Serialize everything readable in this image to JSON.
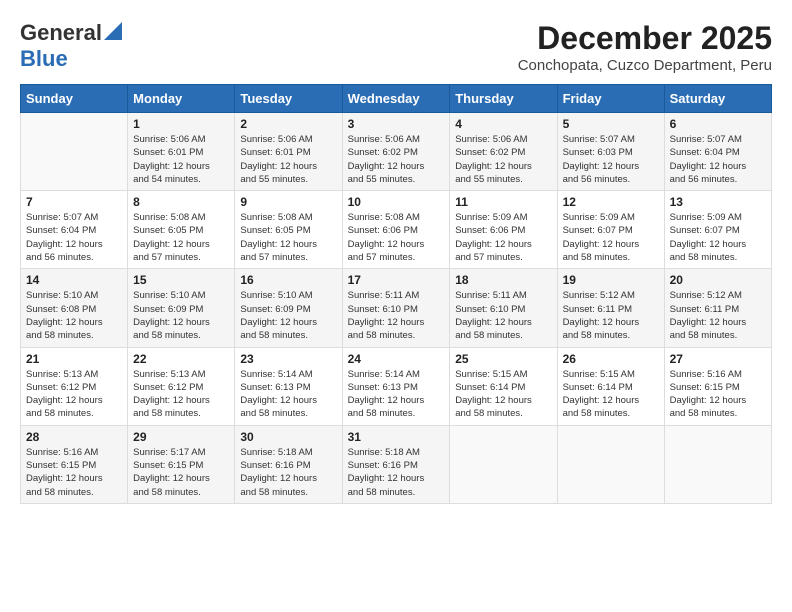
{
  "logo": {
    "general": "General",
    "blue": "Blue"
  },
  "title": "December 2025",
  "subtitle": "Conchopata, Cuzco Department, Peru",
  "header_days": [
    "Sunday",
    "Monday",
    "Tuesday",
    "Wednesday",
    "Thursday",
    "Friday",
    "Saturday"
  ],
  "weeks": [
    [
      {
        "day": "",
        "info": ""
      },
      {
        "day": "1",
        "info": "Sunrise: 5:06 AM\nSunset: 6:01 PM\nDaylight: 12 hours\nand 54 minutes."
      },
      {
        "day": "2",
        "info": "Sunrise: 5:06 AM\nSunset: 6:01 PM\nDaylight: 12 hours\nand 55 minutes."
      },
      {
        "day": "3",
        "info": "Sunrise: 5:06 AM\nSunset: 6:02 PM\nDaylight: 12 hours\nand 55 minutes."
      },
      {
        "day": "4",
        "info": "Sunrise: 5:06 AM\nSunset: 6:02 PM\nDaylight: 12 hours\nand 55 minutes."
      },
      {
        "day": "5",
        "info": "Sunrise: 5:07 AM\nSunset: 6:03 PM\nDaylight: 12 hours\nand 56 minutes."
      },
      {
        "day": "6",
        "info": "Sunrise: 5:07 AM\nSunset: 6:04 PM\nDaylight: 12 hours\nand 56 minutes."
      }
    ],
    [
      {
        "day": "7",
        "info": "Sunrise: 5:07 AM\nSunset: 6:04 PM\nDaylight: 12 hours\nand 56 minutes."
      },
      {
        "day": "8",
        "info": "Sunrise: 5:08 AM\nSunset: 6:05 PM\nDaylight: 12 hours\nand 57 minutes."
      },
      {
        "day": "9",
        "info": "Sunrise: 5:08 AM\nSunset: 6:05 PM\nDaylight: 12 hours\nand 57 minutes."
      },
      {
        "day": "10",
        "info": "Sunrise: 5:08 AM\nSunset: 6:06 PM\nDaylight: 12 hours\nand 57 minutes."
      },
      {
        "day": "11",
        "info": "Sunrise: 5:09 AM\nSunset: 6:06 PM\nDaylight: 12 hours\nand 57 minutes."
      },
      {
        "day": "12",
        "info": "Sunrise: 5:09 AM\nSunset: 6:07 PM\nDaylight: 12 hours\nand 58 minutes."
      },
      {
        "day": "13",
        "info": "Sunrise: 5:09 AM\nSunset: 6:07 PM\nDaylight: 12 hours\nand 58 minutes."
      }
    ],
    [
      {
        "day": "14",
        "info": "Sunrise: 5:10 AM\nSunset: 6:08 PM\nDaylight: 12 hours\nand 58 minutes."
      },
      {
        "day": "15",
        "info": "Sunrise: 5:10 AM\nSunset: 6:09 PM\nDaylight: 12 hours\nand 58 minutes."
      },
      {
        "day": "16",
        "info": "Sunrise: 5:10 AM\nSunset: 6:09 PM\nDaylight: 12 hours\nand 58 minutes."
      },
      {
        "day": "17",
        "info": "Sunrise: 5:11 AM\nSunset: 6:10 PM\nDaylight: 12 hours\nand 58 minutes."
      },
      {
        "day": "18",
        "info": "Sunrise: 5:11 AM\nSunset: 6:10 PM\nDaylight: 12 hours\nand 58 minutes."
      },
      {
        "day": "19",
        "info": "Sunrise: 5:12 AM\nSunset: 6:11 PM\nDaylight: 12 hours\nand 58 minutes."
      },
      {
        "day": "20",
        "info": "Sunrise: 5:12 AM\nSunset: 6:11 PM\nDaylight: 12 hours\nand 58 minutes."
      }
    ],
    [
      {
        "day": "21",
        "info": "Sunrise: 5:13 AM\nSunset: 6:12 PM\nDaylight: 12 hours\nand 58 minutes."
      },
      {
        "day": "22",
        "info": "Sunrise: 5:13 AM\nSunset: 6:12 PM\nDaylight: 12 hours\nand 58 minutes."
      },
      {
        "day": "23",
        "info": "Sunrise: 5:14 AM\nSunset: 6:13 PM\nDaylight: 12 hours\nand 58 minutes."
      },
      {
        "day": "24",
        "info": "Sunrise: 5:14 AM\nSunset: 6:13 PM\nDaylight: 12 hours\nand 58 minutes."
      },
      {
        "day": "25",
        "info": "Sunrise: 5:15 AM\nSunset: 6:14 PM\nDaylight: 12 hours\nand 58 minutes."
      },
      {
        "day": "26",
        "info": "Sunrise: 5:15 AM\nSunset: 6:14 PM\nDaylight: 12 hours\nand 58 minutes."
      },
      {
        "day": "27",
        "info": "Sunrise: 5:16 AM\nSunset: 6:15 PM\nDaylight: 12 hours\nand 58 minutes."
      }
    ],
    [
      {
        "day": "28",
        "info": "Sunrise: 5:16 AM\nSunset: 6:15 PM\nDaylight: 12 hours\nand 58 minutes."
      },
      {
        "day": "29",
        "info": "Sunrise: 5:17 AM\nSunset: 6:15 PM\nDaylight: 12 hours\nand 58 minutes."
      },
      {
        "day": "30",
        "info": "Sunrise: 5:18 AM\nSunset: 6:16 PM\nDaylight: 12 hours\nand 58 minutes."
      },
      {
        "day": "31",
        "info": "Sunrise: 5:18 AM\nSunset: 6:16 PM\nDaylight: 12 hours\nand 58 minutes."
      },
      {
        "day": "",
        "info": ""
      },
      {
        "day": "",
        "info": ""
      },
      {
        "day": "",
        "info": ""
      }
    ]
  ]
}
